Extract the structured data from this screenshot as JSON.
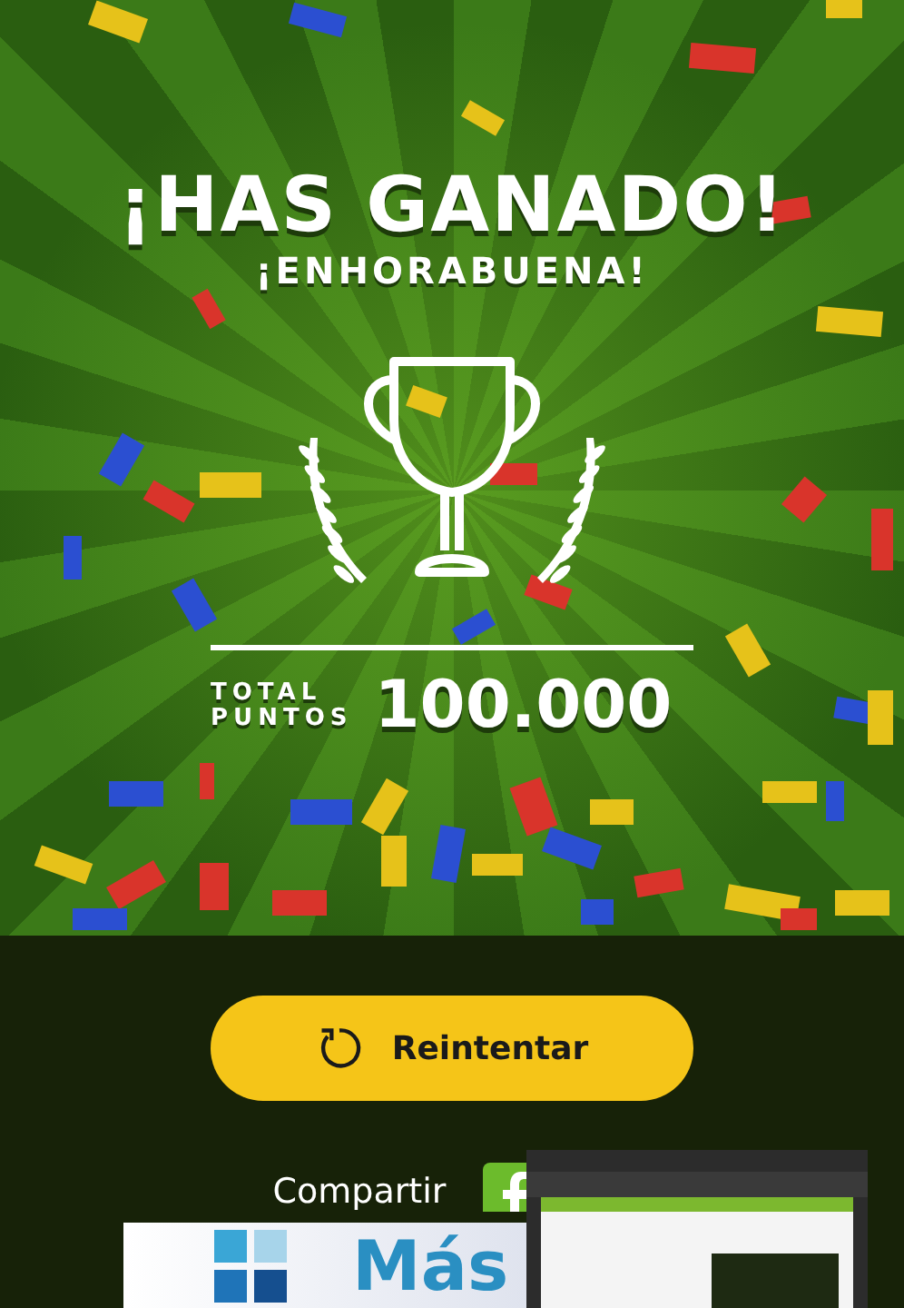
{
  "title": "¡HAS GANADO!",
  "subtitle": "¡ENHORABUENA!",
  "score": {
    "label_lines": [
      "TOTAL",
      "PUNTOS"
    ],
    "value": "100.000"
  },
  "retry_button": {
    "label": "Reintentar"
  },
  "share": {
    "label": "Compartir"
  },
  "ad_banner": {
    "text": "Más"
  }
}
